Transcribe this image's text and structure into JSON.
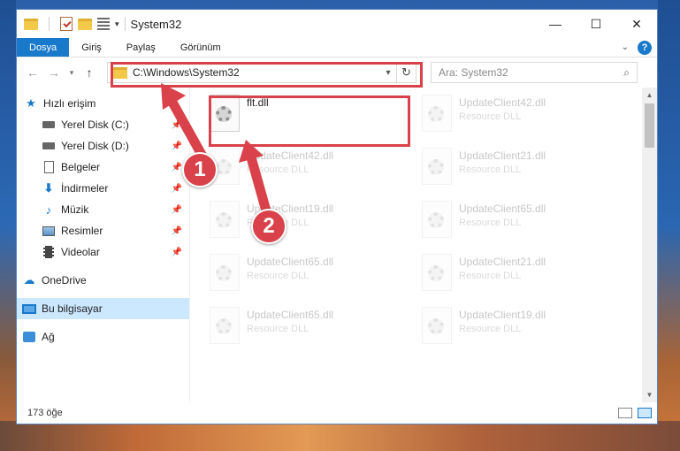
{
  "window": {
    "title": "System32",
    "minimize": "—",
    "maximize": "☐",
    "close": "✕"
  },
  "ribbon": {
    "tabs": [
      "Dosya",
      "Giriş",
      "Paylaş",
      "Görünüm"
    ],
    "expand": "⌄",
    "help": "?"
  },
  "address": {
    "path": "C:\\Windows\\System32",
    "search_placeholder": "Ara: System32"
  },
  "sidebar": {
    "quick_access": "Hızlı erişim",
    "pinned": [
      {
        "label": "Yerel Disk (C:)",
        "icon": "drive-icon"
      },
      {
        "label": "Yerel Disk (D:)",
        "icon": "drive-icon"
      },
      {
        "label": "Belgeler",
        "icon": "document-icon"
      },
      {
        "label": "İndirmeler",
        "icon": "download-icon"
      },
      {
        "label": "Müzik",
        "icon": "music-icon"
      },
      {
        "label": "Resimler",
        "icon": "pictures-icon"
      },
      {
        "label": "Videolar",
        "icon": "video-icon"
      }
    ],
    "onedrive": "OneDrive",
    "this_pc": "Bu bilgisayar",
    "network": "Ağ"
  },
  "files": [
    {
      "name": "flt.dll",
      "type": "",
      "highlighted": true
    },
    {
      "name": "UpdateClient42.dll",
      "type": "Resource DLL"
    },
    {
      "name": "UpdateClient42.dll",
      "type": "Resource DLL"
    },
    {
      "name": "UpdateClient21.dll",
      "type": "Resource DLL"
    },
    {
      "name": "UpdateClient19.dll",
      "type": "Resource DLL"
    },
    {
      "name": "UpdateClient65.dll",
      "type": "Resource DLL"
    },
    {
      "name": "UpdateClient65.dll",
      "type": "Resource DLL"
    },
    {
      "name": "UpdateClient21.dll",
      "type": "Resource DLL"
    },
    {
      "name": "UpdateClient65.dll",
      "type": "Resource DLL"
    },
    {
      "name": "UpdateClient19.dll",
      "type": "Resource DLL"
    }
  ],
  "status": {
    "count": "173 öğe"
  },
  "annotations": {
    "step1": "1",
    "step2": "2"
  },
  "colors": {
    "accent": "#1979ca",
    "highlight": "#d9424a",
    "selected": "#cce8ff"
  }
}
